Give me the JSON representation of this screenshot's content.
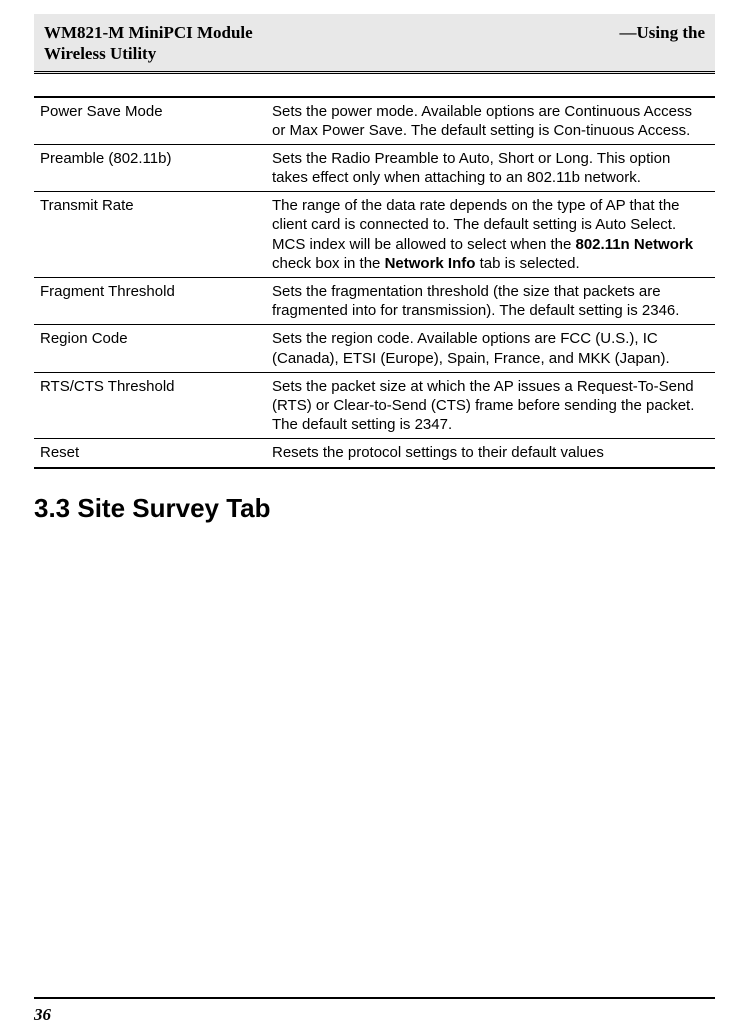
{
  "header": {
    "left_line1": "WM821-M MiniPCI Module",
    "left_line2": "Wireless Utility",
    "right_line1": "—Using the"
  },
  "table": {
    "rows": [
      {
        "name": "Power Save Mode",
        "desc": "Sets the power mode. Available options are Continuous Access or Max Power Save. The default setting is Con-tinuous Access."
      },
      {
        "name": "Preamble (802.11b)",
        "desc": "Sets the Radio Preamble to Auto, Short or Long. This option takes effect only when attaching to an 802.11b network."
      },
      {
        "name": "Transmit Rate",
        "desc_pre": "The range of the data rate depends on the type of AP that the client card is connected to. The default setting is Auto Select. MCS index will be allowed to select when the ",
        "desc_b1": "802.11n Network",
        "desc_mid": " check box in the ",
        "desc_b2": "Network Info",
        "desc_post": " tab is selected."
      },
      {
        "name": "Fragment Threshold",
        "desc": "Sets the fragmentation threshold (the size that packets are fragmented into for transmission). The default setting is 2346."
      },
      {
        "name": "Region Code",
        "desc": "Sets the region code. Available options are FCC (U.S.), IC (Canada), ETSI (Europe), Spain, France, and MKK (Japan)."
      },
      {
        "name": "RTS/CTS Threshold",
        "desc": "Sets the packet size at which the AP issues a Request-To-Send (RTS) or Clear-to-Send (CTS) frame before sending the packet. The default setting is 2347."
      },
      {
        "name": "Reset",
        "desc": "Resets the protocol settings to their default values"
      }
    ]
  },
  "section_heading": "3.3 Site Survey Tab",
  "page_number": "36"
}
